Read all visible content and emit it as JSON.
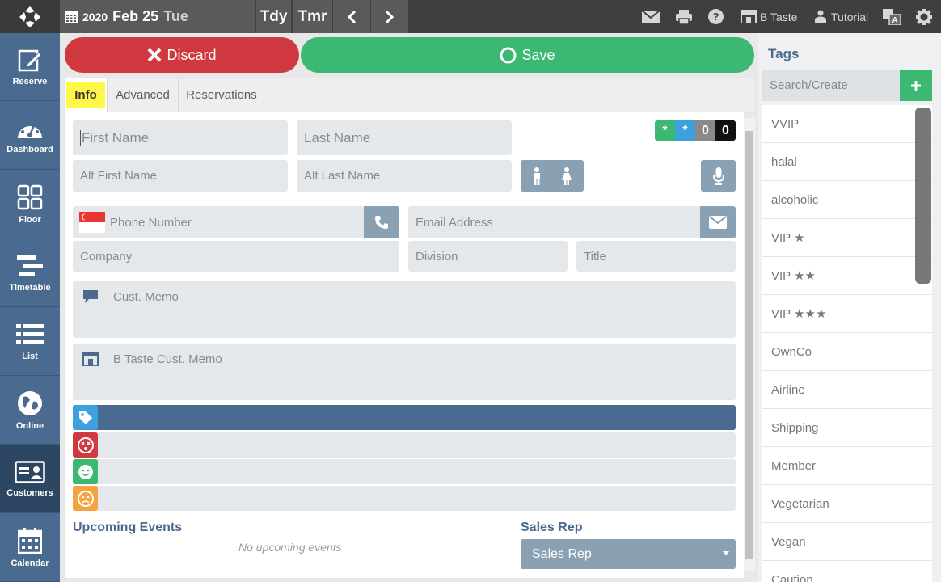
{
  "topbar": {
    "year": "2020",
    "month_day": "Feb 25",
    "weekday": "Tue",
    "today_label": "Tdy",
    "tomorrow_label": "Tmr",
    "restaurant_label": "B Taste",
    "tutorial_label": "Tutorial"
  },
  "leftnav": {
    "items": [
      {
        "label": "Reserve",
        "icon": "edit-icon"
      },
      {
        "label": "Dashboard",
        "icon": "gauge-icon"
      },
      {
        "label": "Floor",
        "icon": "grid-icon"
      },
      {
        "label": "Timetable",
        "icon": "timetable-icon"
      },
      {
        "label": "List",
        "icon": "list-icon"
      },
      {
        "label": "Online",
        "icon": "globe-icon"
      },
      {
        "label": "Customers",
        "icon": "id-card-icon",
        "active": true
      },
      {
        "label": "Calendar",
        "icon": "calendar-icon"
      }
    ]
  },
  "actions": {
    "discard_label": "Discard",
    "save_label": "Save"
  },
  "tabs": [
    {
      "label": "Info",
      "active": true
    },
    {
      "label": "Advanced"
    },
    {
      "label": "Reservations"
    }
  ],
  "form": {
    "first_name_placeholder": "First Name",
    "last_name_placeholder": "Last Name",
    "alt_first_name_placeholder": "Alt First Name",
    "alt_last_name_placeholder": "Alt Last Name",
    "phone_placeholder": "Phone Number",
    "email_placeholder": "Email Address",
    "company_placeholder": "Company",
    "division_placeholder": "Division",
    "title_placeholder": "Title",
    "cust_memo_placeholder": "Cust. Memo",
    "btaste_memo_placeholder": "B Taste Cust. Memo",
    "badges": [
      "*",
      "*",
      "0",
      "0"
    ]
  },
  "upcoming": {
    "title": "Upcoming Events",
    "empty_text": "No upcoming events"
  },
  "sales_rep": {
    "title": "Sales Rep",
    "selected": "Sales Rep"
  },
  "tags": {
    "title": "Tags",
    "search_placeholder": "Search/Create",
    "items": [
      "VVIP",
      "halal",
      "alcoholic",
      "VIP ★",
      "VIP ★★",
      "VIP ★★★",
      "OwnCo",
      "Airline",
      "Shipping",
      "Member",
      "Vegetarian",
      "Vegan",
      "Caution"
    ]
  },
  "colors": {
    "nav_bg": "#4a6a8f",
    "discard": "#d0393f",
    "save": "#3bb871",
    "tab_highlight": "#fff84a"
  }
}
